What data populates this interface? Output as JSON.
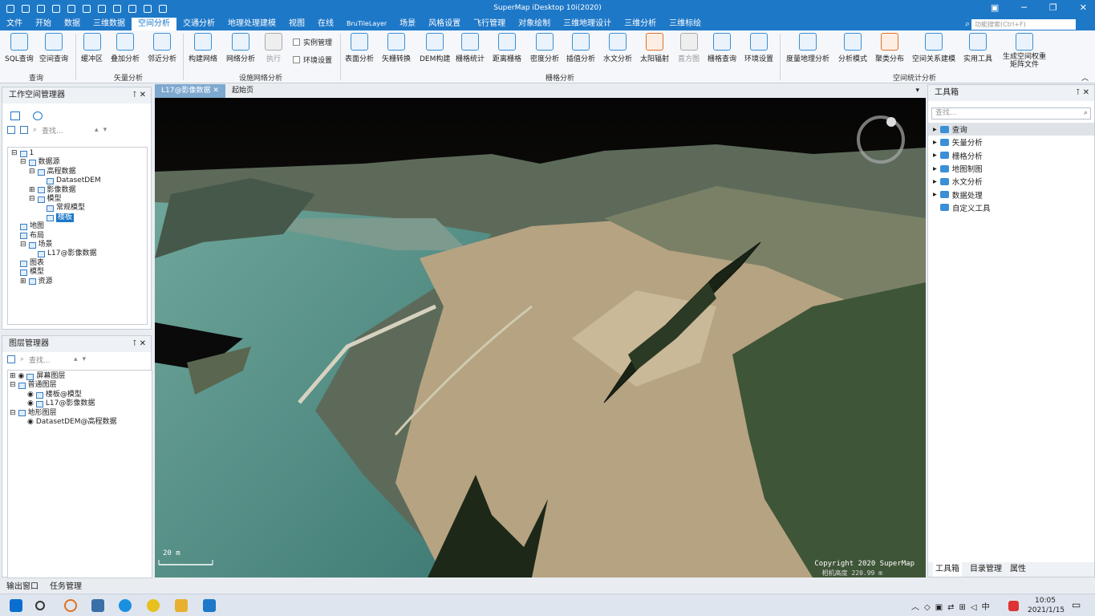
{
  "app": {
    "title": "SuperMap iDesktop 10i(2020)"
  },
  "menu": [
    "文件",
    "开始",
    "数据",
    "三维数据",
    "空间分析",
    "交通分析",
    "地理处理建模",
    "视图",
    "在线",
    "BruTileLayer",
    "场景",
    "风格设置",
    "飞行管理",
    "对象绘制",
    "三维地理设计",
    "三维分析",
    "三维标绘"
  ],
  "menu_active": "空间分析",
  "search": {
    "placeholder": "功能搜索(Ctrl+F)"
  },
  "ribbon": {
    "buttons": [
      "SQL查询",
      "空间查询",
      "缓冲区",
      "叠加分析",
      "邻近分析",
      "构建网络",
      "网络分析",
      "执行",
      "表面分析",
      "矢栅转换",
      "DEM构建",
      "栅格统计",
      "距离栅格",
      "密度分析",
      "插值分析",
      "水文分析",
      "太阳辐射",
      "直方图",
      "栅格查询",
      "环境设置",
      "度量地理分析",
      "分析模式",
      "聚类分布",
      "空间关系建模",
      "实用工具",
      "生成空间权重矩阵文件"
    ],
    "checks": [
      "实例管理",
      "环境设置"
    ],
    "groups": [
      "查询",
      "矢量分析",
      "设施网络分析",
      "栅格分析",
      "空间统计分析"
    ]
  },
  "workspace": {
    "title": "工作空间管理器",
    "search_placeholder": "查找...",
    "tree": [
      "1",
      "数据源",
      "高程数据",
      "DatasetDEM",
      "影像数据",
      "模型",
      "常规模型",
      "楼板",
      "地图",
      "布局",
      "场景",
      "L17@影像数据",
      "图表",
      "模型",
      "资源"
    ]
  },
  "layers": {
    "title": "图层管理器",
    "search_placeholder": "查找...",
    "tree": [
      "屏幕图层",
      "普通图层",
      "楼板@模型",
      "L17@影像数据",
      "地形图层",
      "DatasetDEM@高程数据"
    ]
  },
  "tabs": [
    "L17@影像数据",
    "起始页"
  ],
  "scene": {
    "scale": "20 m",
    "copyright": "Copyright 2020 SuperMap",
    "camera": "相机高度 220.99 m"
  },
  "toolbox": {
    "title": "工具箱",
    "search_placeholder": "查找...",
    "items": [
      "查询",
      "矢量分析",
      "栅格分析",
      "地图制图",
      "水文分析",
      "数据处理",
      "自定义工具"
    ],
    "tabs": [
      "工具箱",
      "目录管理",
      "属性"
    ]
  },
  "bottom": [
    "输出窗口",
    "任务管理"
  ],
  "clock": {
    "time": "10:05",
    "date": "2021/1/15"
  },
  "colors": {
    "accent": "#1e78c8"
  }
}
